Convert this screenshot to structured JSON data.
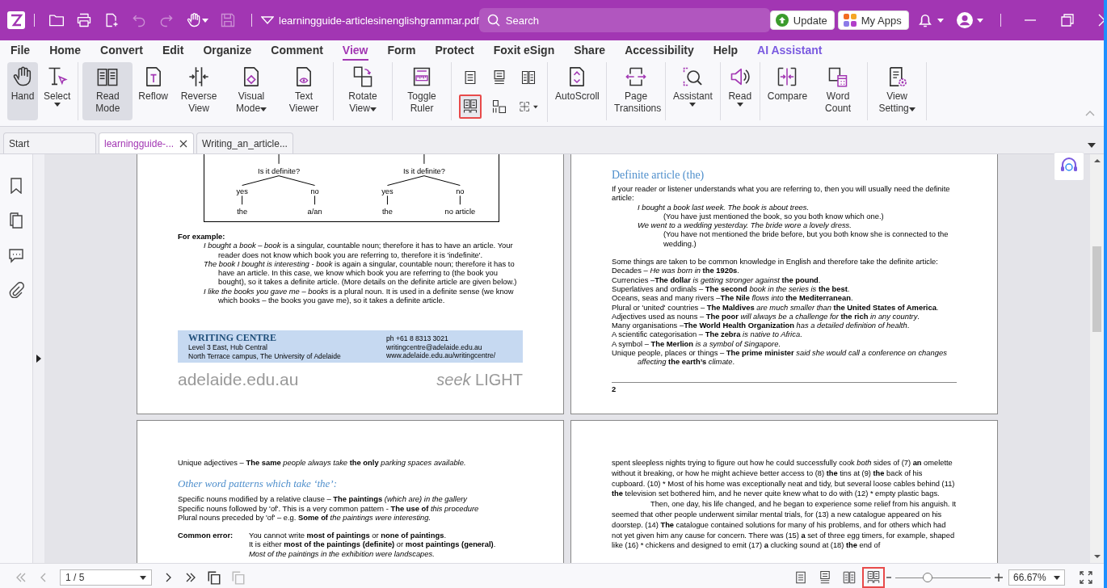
{
  "title_bar": {
    "quick_tools": [
      {
        "disabled": false
      },
      {
        "disabled": false
      },
      {
        "disabled": false
      },
      {
        "disabled": true
      },
      {
        "disabled": true
      },
      {
        "disabled": false
      },
      {
        "disabled": true
      }
    ],
    "file_name": "learningguide-articlesinenglishgrammar.pdf",
    "search": {
      "placeholder": "Search"
    },
    "buttons": [
      {
        "label": "Update",
        "kind": "update"
      },
      {
        "label": "My Apps",
        "kind": "apps"
      }
    ]
  },
  "menu": [
    {
      "label": "File",
      "selected": false,
      "kind": "plain"
    },
    {
      "label": "Home",
      "selected": false,
      "kind": "plain"
    },
    {
      "label": "Convert",
      "selected": false,
      "kind": "plain"
    },
    {
      "label": "Edit",
      "selected": false,
      "kind": "plain"
    },
    {
      "label": "Organize",
      "selected": false,
      "kind": "plain"
    },
    {
      "label": "Comment",
      "selected": false,
      "kind": "plain"
    },
    {
      "label": "View",
      "selected": true,
      "kind": "plain"
    },
    {
      "label": "Form",
      "selected": false,
      "kind": "plain"
    },
    {
      "label": "Protect",
      "selected": false,
      "kind": "plain"
    },
    {
      "label": "Foxit eSign",
      "selected": false,
      "kind": "plain"
    },
    {
      "label": "Share",
      "selected": false,
      "kind": "plain"
    },
    {
      "label": "Accessibility",
      "selected": false,
      "kind": "plain"
    },
    {
      "label": "Help",
      "selected": false,
      "kind": "plain"
    },
    {
      "label": "AI Assistant",
      "selected": false,
      "kind": "ai"
    }
  ],
  "ribbon": [
    {
      "kind": "buttons",
      "items": [
        {
          "label": "Hand",
          "selected": true,
          "dropdown": false
        },
        {
          "label": "Select",
          "selected": false,
          "dropdown": true
        }
      ]
    },
    {
      "kind": "buttons",
      "items": [
        {
          "label": "Read Mode",
          "selected": true,
          "dropdown": false
        },
        {
          "label": "Reflow",
          "selected": false,
          "dropdown": false
        },
        {
          "label": "Reverse View",
          "selected": false,
          "dropdown": false
        },
        {
          "label": "Visual Mode",
          "selected": false,
          "dropdown": true
        },
        {
          "label": "Text Viewer",
          "selected": false,
          "dropdown": false
        }
      ]
    },
    {
      "kind": "buttons",
      "items": [
        {
          "label": "Rotate View",
          "selected": false,
          "dropdown": true
        }
      ]
    },
    {
      "kind": "buttons",
      "items": [
        {
          "label": "Toggle Ruler",
          "selected": false,
          "dropdown": false
        }
      ]
    },
    {
      "kind": "grid",
      "items": [
        {
          "selected": false,
          "highlighted": false,
          "dropdown": false
        },
        {
          "selected": false,
          "highlighted": false,
          "dropdown": false
        },
        {
          "selected": false,
          "highlighted": false,
          "dropdown": false
        },
        {
          "selected": false,
          "highlighted": true,
          "dropdown": false
        },
        {
          "selected": false,
          "highlighted": false,
          "dropdown": false
        },
        {
          "selected": false,
          "highlighted": false,
          "dropdown": true
        }
      ]
    },
    {
      "kind": "buttons",
      "items": [
        {
          "label": "AutoScroll",
          "selected": false,
          "dropdown": false
        }
      ]
    },
    {
      "kind": "buttons",
      "items": [
        {
          "label": "Page Transitions",
          "selected": false,
          "dropdown": false
        }
      ]
    },
    {
      "kind": "buttons",
      "items": [
        {
          "label": "Assistant",
          "selected": false,
          "dropdown": true
        }
      ]
    },
    {
      "kind": "buttons",
      "items": [
        {
          "label": "Read",
          "selected": false,
          "dropdown": true
        }
      ]
    },
    {
      "kind": "buttons",
      "items": [
        {
          "label": "Compare",
          "selected": false,
          "dropdown": false
        },
        {
          "label": "Word Count",
          "selected": false,
          "dropdown": false
        }
      ]
    },
    {
      "kind": "buttons",
      "items": [
        {
          "label": "View Setting",
          "selected": false,
          "dropdown": true
        }
      ]
    }
  ],
  "doc_tabs": [
    {
      "label": "Start",
      "selected": false,
      "closable": false
    },
    {
      "label": "learningguide-...",
      "selected": true,
      "closable": true
    },
    {
      "label": "Writing_an_article...",
      "selected": false,
      "closable": false
    }
  ],
  "pages": [
    {
      "blocks": [
        {
          "kind": "diagram",
          "trees": [
            {
              "question": "Is it definite?",
              "branches": [
                {
                  "answer": "yes",
                  "result": "the"
                },
                {
                  "answer": "no",
                  "result": "a/an"
                }
              ]
            },
            {
              "question": "Is it definite?",
              "branches": [
                {
                  "answer": "yes",
                  "result": "the"
                },
                {
                  "answer": "no",
                  "result": "no article"
                }
              ]
            }
          ]
        },
        {
          "kind": "bold-heading",
          "text": "For example:"
        },
        {
          "kind": "example",
          "text": "*I bought a book* – *book* is a singular, countable noun; therefore it has to have an article. Your reader does not know which book you are referring to, therefore it is 'indefinite'."
        },
        {
          "kind": "example",
          "text": "*The book I bought is interesting* - *book* is again a singular, countable noun; therefore it has to have an article. In this case, we know which book you are referring to (the book you bought), so it takes a definite article. (More details on the definite article are given below.)"
        },
        {
          "kind": "example",
          "text": "*I like the books you gave me* – *books* is a plural noun. It is used in a definite sense (we know which books – the books you gave me), so it takes a definite article."
        },
        {
          "kind": "footer",
          "name": "WRITING CENTRE",
          "address": [
            "Level 3 East, Hub Central",
            "North Terrace campus, The University of Adelaide"
          ],
          "contact": [
            "ph  +61 8 8313 3021",
            "writingcentre@adelaide.edu.au",
            "www.adelaide.edu.au/writingcentre/"
          ]
        },
        {
          "kind": "brand",
          "site": "adelaide.edu.au",
          "slogan": "*seek* LIGHT"
        }
      ]
    },
    {
      "blocks": [
        {
          "kind": "heading",
          "text": "Definite article (the)"
        },
        {
          "kind": "line",
          "text": "If your reader or listener understands what you are referring to, then you will usually need the definite article:"
        },
        {
          "kind": "example-italic",
          "text": "I bought a book last week. The book is about trees."
        },
        {
          "kind": "note",
          "text": "(You have just mentioned the book, so you both know which one.)"
        },
        {
          "kind": "example-italic",
          "text": "We went to a wedding yesterday. The bride wore a lovely dress."
        },
        {
          "kind": "note",
          "text": "(You have not mentioned the bride before, but you both know she is connected to the wedding.)"
        },
        {
          "kind": "paragraph",
          "text": "Some things are taken to be common knowledge in English and therefore take the definite article:"
        },
        {
          "kind": "line",
          "text": "Decades – *He was born in* **the 1920s**."
        },
        {
          "kind": "line",
          "text": "Currencies –**The dollar** *is getting stronger against* **the pound**."
        },
        {
          "kind": "line",
          "text": "Superlatives and ordinals – **The second** *book in the series is* **the best**."
        },
        {
          "kind": "line",
          "text": "Oceans, seas and many rivers –**The Nile** *flows into* **the Mediterranean**."
        },
        {
          "kind": "line",
          "text": "Plural or 'united' countries – **The Maldives** *are much smaller than* **the United States of America**."
        },
        {
          "kind": "line",
          "text": "Adjectives used as nouns – **The poor** *will always be a challenge for* **the rich** *in any country*."
        },
        {
          "kind": "line",
          "text": "Many organisations –**The World Health Organization** *has a detailed definition of health*."
        },
        {
          "kind": "line",
          "text": "A scientific categorisation – **The zebra** *is native to Africa*."
        },
        {
          "kind": "line",
          "text": "A symbol – **The Merlion** *is a symbol of Singapore*."
        },
        {
          "kind": "hanging",
          "text": "Unique people, places or things – **The prime minister** *said she would call a conference on changes affecting* **the earth’s** *climate*."
        },
        {
          "kind": "rule"
        },
        {
          "kind": "page-number",
          "text": "2"
        }
      ]
    },
    {
      "blocks": [
        {
          "kind": "line",
          "text": "Unique adjectives – **The same** *people always take* **the only** *parking spaces available.*"
        },
        {
          "kind": "heading-italic",
          "text": "Other word patterns which take ‘the’:"
        },
        {
          "kind": "line",
          "text": "Specific nouns modified by a relative clause – **The paintings** *(which are) in the gallery*"
        },
        {
          "kind": "line",
          "text": "Specific nouns followed by 'of'. This is a very common pattern - **The use of** *this procedure*"
        },
        {
          "kind": "line",
          "text": "Plural nouns preceded by 'of' – e.g. **Some of** *the paintings were interesting.*"
        },
        {
          "kind": "labelled",
          "label": "Common error:",
          "lines": [
            {
              "kind": "line",
              "text": "You cannot write **most of paintings** or **none of paintings**."
            },
            {
              "kind": "line",
              "text": "It is either **most of the paintings** **(definite)** or **most paintings** **(general)**."
            },
            {
              "kind": "example-italic",
              "text": "Most of the paintings in the exhibition were landscapes."
            }
          ]
        }
      ]
    },
    {
      "blocks": [
        {
          "kind": "body",
          "text": "spent sleepless nights trying to figure out how he could successfully cook *both* sides of (7) **an** omelette without it breaking, or how he might achieve better access to (8) **the** tins at (9) **the** back of his cupboard. (10) * Most of his home was exceptionally neat and tidy, but several loose cables behind (11) **the** television set bothered him, and he never quite knew what to do with (12) * empty plastic bags."
        },
        {
          "kind": "body-indent",
          "text": "Then, one day, his life changed, and he began to experience some relief from his anguish. It seemed that other people underwent similar mental trials, for (13) a new catalogue appeared on his doorstep. (14) **The** catalogue contained solutions for many of his problems, and for others which had not yet given him any cause for concern. There was (15) **a** set of three egg timers, for example, shaped like (16) * chickens and designed to emit (17) **a** clucking sound at (18) **the** end of"
        }
      ]
    }
  ],
  "status_bar": {
    "page": "1 / 5",
    "views": [
      {
        "highlighted": false
      },
      {
        "highlighted": false
      },
      {
        "highlighted": false
      },
      {
        "highlighted": true
      }
    ],
    "zoom": {
      "level": 0.34,
      "value": "66.67%"
    }
  }
}
